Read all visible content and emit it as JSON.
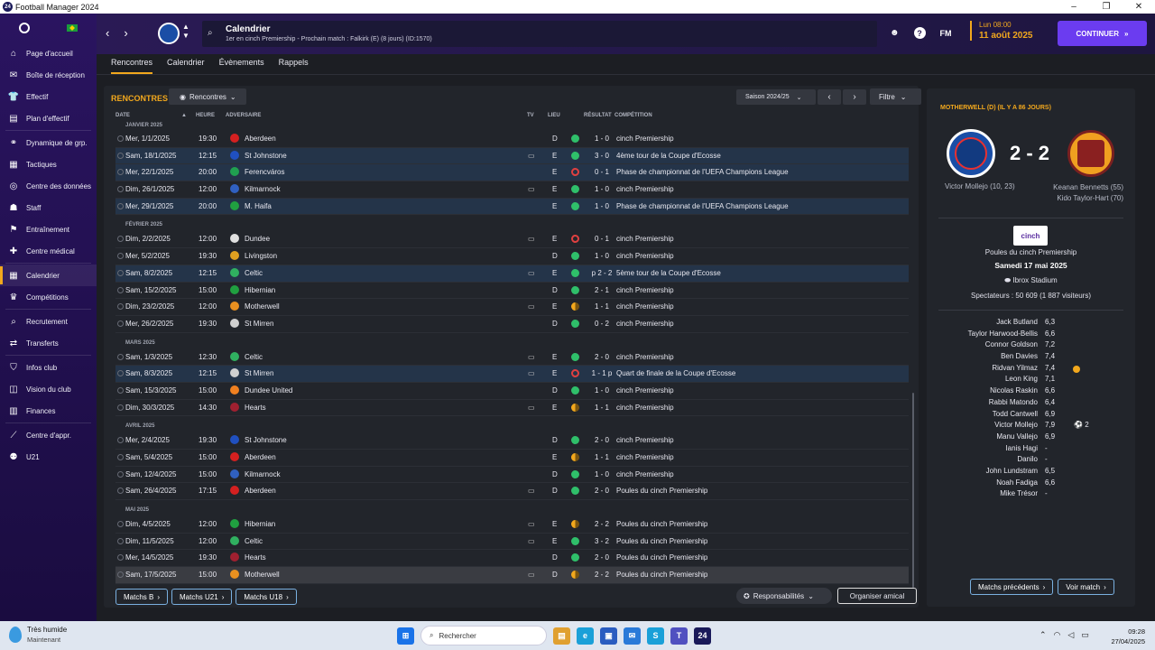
{
  "window": {
    "title": "Football Manager 2024",
    "app_icon": "24"
  },
  "sidebar": {
    "items": [
      {
        "label": "Page d'accueil",
        "icon": "home-icon"
      },
      {
        "label": "Boîte de réception",
        "icon": "inbox-icon"
      },
      {
        "label": "Effectif",
        "icon": "shirt-icon"
      },
      {
        "label": "Plan d'effectif",
        "icon": "clipboard-icon"
      },
      {
        "label": "Dynamique de grp.",
        "icon": "group-dynamics-icon"
      },
      {
        "label": "Tactiques",
        "icon": "tactics-icon"
      },
      {
        "label": "Centre des données",
        "icon": "data-centre-icon"
      },
      {
        "label": "Staff",
        "icon": "staff-icon"
      },
      {
        "label": "Entraînement",
        "icon": "training-icon"
      },
      {
        "label": "Centre médical",
        "icon": "medical-icon"
      },
      {
        "label": "Calendrier",
        "icon": "calendar-icon",
        "active": true
      },
      {
        "label": "Compétitions",
        "icon": "trophy-icon"
      },
      {
        "label": "Recrutement",
        "icon": "scouting-icon"
      },
      {
        "label": "Transferts",
        "icon": "transfers-icon"
      },
      {
        "label": "Infos club",
        "icon": "club-info-icon"
      },
      {
        "label": "Vision du club",
        "icon": "club-vision-icon"
      },
      {
        "label": "Finances",
        "icon": "finances-icon"
      },
      {
        "label": "Centre d'appr.",
        "icon": "development-centre-icon"
      },
      {
        "label": "U21",
        "icon": "u21-icon"
      }
    ]
  },
  "header": {
    "title": "Calendrier",
    "subtitle": "1er en cinch Premiership - Prochain match : Falkirk (E) (8 jours) (ID:1570)",
    "fm_label": "FM",
    "help_label": "?",
    "date_line1": "Lun 08:00",
    "date_line2": "11 août 2025",
    "continue_label": "CONTINUER"
  },
  "tabs": [
    "Rencontres",
    "Calendrier",
    "Évènements",
    "Rappels"
  ],
  "main": {
    "section_title": "RENCONTRES",
    "dropdown_label": "Rencontres",
    "season_label": "Saison 2024/25",
    "filter_label": "Filtre",
    "columns": {
      "date": "DATE",
      "heure": "HEURE",
      "adversaire": "ADVERSAIRE",
      "tv": "TV",
      "lieu": "LIEU",
      "resultat": "RÉSULTAT",
      "competition": "COMPÉTITION"
    },
    "months": [
      "JANVIER 2025",
      "FÉVRIER 2025",
      "MARS 2025",
      "AVRIL 2025",
      "MAI 2025"
    ],
    "matches": [
      {
        "m": 0,
        "date": "Mer, 1/1/2025",
        "heure": "19:30",
        "opp": "Aberdeen",
        "tv": false,
        "lieu": "D",
        "res": "w",
        "score": "1 - 0",
        "comp": "cinch Premiership",
        "hl": false,
        "crest": "#d42020"
      },
      {
        "m": 0,
        "date": "Sam, 18/1/2025",
        "heure": "12:15",
        "opp": "St Johnstone",
        "tv": true,
        "lieu": "E",
        "res": "w",
        "score": "3 - 0",
        "comp": "4ème tour de la Coupe d'Ecosse",
        "hl": true,
        "crest": "#2050c0"
      },
      {
        "m": 0,
        "date": "Mer, 22/1/2025",
        "heure": "20:00",
        "opp": "Ferencváros",
        "tv": false,
        "lieu": "E",
        "res": "l",
        "score": "0 - 1",
        "comp": "Phase de championnat de l'UEFA Champions League",
        "hl": true,
        "crest": "#20a050"
      },
      {
        "m": 0,
        "date": "Dim, 26/1/2025",
        "heure": "12:00",
        "opp": "Kilmarnock",
        "tv": true,
        "lieu": "E",
        "res": "w",
        "score": "1 - 0",
        "comp": "cinch Premiership",
        "hl": false,
        "crest": "#3060c0"
      },
      {
        "m": 0,
        "date": "Mer, 29/1/2025",
        "heure": "20:00",
        "opp": "M. Haifa",
        "tv": false,
        "lieu": "E",
        "res": "w",
        "score": "1 - 0",
        "comp": "Phase de championnat de l'UEFA Champions League",
        "hl": true,
        "crest": "#20a040"
      },
      {
        "m": 1,
        "date": "Dim, 2/2/2025",
        "heure": "12:00",
        "opp": "Dundee",
        "tv": true,
        "lieu": "E",
        "res": "l",
        "score": "0 - 1",
        "comp": "cinch Premiership",
        "hl": false,
        "crest": "#e0e0e0"
      },
      {
        "m": 1,
        "date": "Mer, 5/2/2025",
        "heure": "19:30",
        "opp": "Livingston",
        "tv": false,
        "lieu": "D",
        "res": "w",
        "score": "1 - 0",
        "comp": "cinch Premiership",
        "hl": false,
        "crest": "#e0a020"
      },
      {
        "m": 1,
        "date": "Sam, 8/2/2025",
        "heure": "12:15",
        "opp": "Celtic",
        "tv": true,
        "lieu": "E",
        "res": "w",
        "score": "p 2 - 2",
        "comp": "5ème tour de la Coupe d'Ecosse",
        "hl": true,
        "crest": "#30b060"
      },
      {
        "m": 1,
        "date": "Sam, 15/2/2025",
        "heure": "15:00",
        "opp": "Hibernian",
        "tv": false,
        "lieu": "D",
        "res": "w",
        "score": "2 - 1",
        "comp": "cinch Premiership",
        "hl": false,
        "crest": "#20a040"
      },
      {
        "m": 1,
        "date": "Dim, 23/2/2025",
        "heure": "12:00",
        "opp": "Motherwell",
        "tv": true,
        "lieu": "E",
        "res": "d",
        "score": "1 - 1",
        "comp": "cinch Premiership",
        "hl": false,
        "crest": "#e89020"
      },
      {
        "m": 1,
        "date": "Mer, 26/2/2025",
        "heure": "19:30",
        "opp": "St Mirren",
        "tv": false,
        "lieu": "D",
        "res": "w",
        "score": "0 - 2",
        "comp": "cinch Premiership",
        "hl": false,
        "crest": "#d0d0d0"
      },
      {
        "m": 2,
        "date": "Sam, 1/3/2025",
        "heure": "12:30",
        "opp": "Celtic",
        "tv": true,
        "lieu": "E",
        "res": "w",
        "score": "2 - 0",
        "comp": "cinch Premiership",
        "hl": false,
        "crest": "#30b060"
      },
      {
        "m": 2,
        "date": "Sam, 8/3/2025",
        "heure": "12:15",
        "opp": "St Mirren",
        "tv": true,
        "lieu": "E",
        "res": "l",
        "score": "1 - 1 p",
        "comp": "Quart de finale de la Coupe d'Ecosse",
        "hl": true,
        "crest": "#d0d0d0"
      },
      {
        "m": 2,
        "date": "Sam, 15/3/2025",
        "heure": "15:00",
        "opp": "Dundee United",
        "tv": false,
        "lieu": "D",
        "res": "w",
        "score": "1 - 0",
        "comp": "cinch Premiership",
        "hl": false,
        "crest": "#f08020"
      },
      {
        "m": 2,
        "date": "Dim, 30/3/2025",
        "heure": "14:30",
        "opp": "Hearts",
        "tv": true,
        "lieu": "E",
        "res": "d",
        "score": "1 - 1",
        "comp": "cinch Premiership",
        "hl": false,
        "crest": "#a02030"
      },
      {
        "m": 3,
        "date": "Mer, 2/4/2025",
        "heure": "19:30",
        "opp": "St Johnstone",
        "tv": false,
        "lieu": "D",
        "res": "w",
        "score": "2 - 0",
        "comp": "cinch Premiership",
        "hl": false,
        "crest": "#2050c0"
      },
      {
        "m": 3,
        "date": "Sam, 5/4/2025",
        "heure": "15:00",
        "opp": "Aberdeen",
        "tv": false,
        "lieu": "E",
        "res": "d",
        "score": "1 - 1",
        "comp": "cinch Premiership",
        "hl": false,
        "crest": "#d42020"
      },
      {
        "m": 3,
        "date": "Sam, 12/4/2025",
        "heure": "15:00",
        "opp": "Kilmarnock",
        "tv": false,
        "lieu": "D",
        "res": "w",
        "score": "1 - 0",
        "comp": "cinch Premiership",
        "hl": false,
        "crest": "#3060c0"
      },
      {
        "m": 3,
        "date": "Sam, 26/4/2025",
        "heure": "17:15",
        "opp": "Aberdeen",
        "tv": true,
        "lieu": "D",
        "res": "w",
        "score": "2 - 0",
        "comp": "Poules du cinch Premiership",
        "hl": false,
        "crest": "#d42020"
      },
      {
        "m": 4,
        "date": "Dim, 4/5/2025",
        "heure": "12:00",
        "opp": "Hibernian",
        "tv": true,
        "lieu": "E",
        "res": "d",
        "score": "2 - 2",
        "comp": "Poules du cinch Premiership",
        "hl": false,
        "crest": "#20a040"
      },
      {
        "m": 4,
        "date": "Dim, 11/5/2025",
        "heure": "12:00",
        "opp": "Celtic",
        "tv": true,
        "lieu": "E",
        "res": "w",
        "score": "3 - 2",
        "comp": "Poules du cinch Premiership",
        "hl": false,
        "crest": "#30b060"
      },
      {
        "m": 4,
        "date": "Mer, 14/5/2025",
        "heure": "19:30",
        "opp": "Hearts",
        "tv": false,
        "lieu": "D",
        "res": "w",
        "score": "2 - 0",
        "comp": "Poules du cinch Premiership",
        "hl": false,
        "crest": "#a02030"
      },
      {
        "m": 4,
        "date": "Sam, 17/5/2025",
        "heure": "15:00",
        "opp": "Motherwell",
        "tv": true,
        "lieu": "D",
        "res": "d",
        "score": "2 - 2",
        "comp": "Poules du cinch Premiership",
        "hl": false,
        "sel": true,
        "crest": "#e89020"
      }
    ],
    "bottom_buttons": [
      "Matchs B",
      "Matchs U21",
      "Matchs U18"
    ],
    "responsibilities_label": "Responsabilités",
    "organiser_label": "Organiser amical"
  },
  "colors": {
    "win": "#2fbf6a",
    "loss": "#e04040",
    "draw": "#f2a81d",
    "accent": "#f2a81d",
    "continue": "#6b3cf0"
  },
  "match_detail": {
    "title": "MOTHERWELL (D) (IL Y A 86 JOURS)",
    "score": "2 - 2",
    "home_scorers": "Victor Mollejo (10, 23)",
    "away_scorers": [
      "Keanan Bennetts (55)",
      "Kido Taylor-Hart (70)"
    ],
    "comp_logo": "cinch",
    "competition": "Poules du cinch Premiership",
    "date": "Samedi 17 mai 2025",
    "stadium": "Ibrox Stadium",
    "spectators": "Spectateurs : 50 609 (1 887 visiteurs)",
    "players": [
      {
        "name": "Jack Butland",
        "rating": "6,3"
      },
      {
        "name": "Taylor Harwood-Bellis",
        "rating": "6,6"
      },
      {
        "name": "Connor Goldson",
        "rating": "7,2"
      },
      {
        "name": "Ben Davies",
        "rating": "7,4"
      },
      {
        "name": "Ridvan Yilmaz",
        "rating": "7,4",
        "star": true
      },
      {
        "name": "Leon King",
        "rating": "7,1"
      },
      {
        "name": "Nicolas Raskin",
        "rating": "6,6"
      },
      {
        "name": "Rabbi Matondo",
        "rating": "6,4"
      },
      {
        "name": "Todd Cantwell",
        "rating": "6,9"
      },
      {
        "name": "Victor Mollejo",
        "rating": "7,9",
        "goals": "2"
      },
      {
        "name": "Manu Vallejo",
        "rating": "6,9"
      },
      {
        "name": "Ianis Hagi",
        "rating": "-"
      },
      {
        "name": "Danilo",
        "rating": "-"
      },
      {
        "name": "John Lundstram",
        "rating": "6,5"
      },
      {
        "name": "Noah Fadiga",
        "rating": "6,6"
      },
      {
        "name": "Mike Trésor",
        "rating": "-"
      }
    ],
    "prev_matches_label": "Matchs précédents",
    "view_match_label": "Voir match"
  },
  "taskbar": {
    "weather_line1": "Très humide",
    "weather_line2": "Maintenant",
    "search_placeholder": "Rechercher",
    "time": "09:28",
    "date": "27/04/2025"
  }
}
